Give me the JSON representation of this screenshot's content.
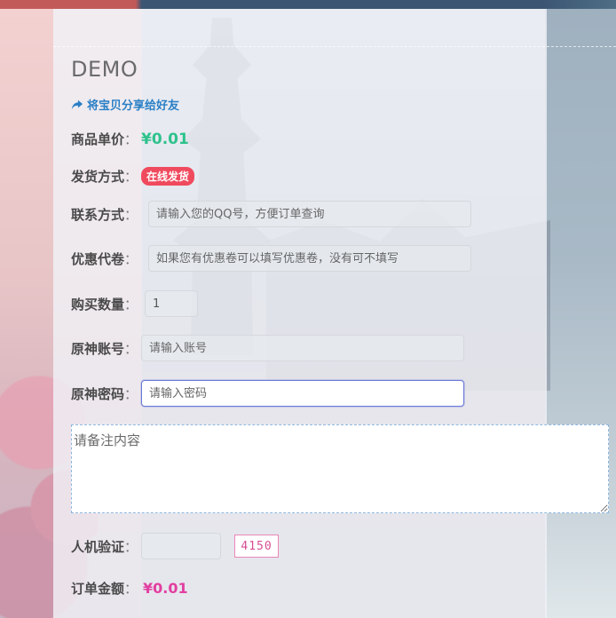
{
  "page": {
    "title": "DEMO",
    "share_label": "将宝贝分享给好友"
  },
  "fields": {
    "unit_price": {
      "label": "商品单价",
      "value": "¥0.01"
    },
    "delivery": {
      "label": "发货方式",
      "badge": "在线发货"
    },
    "contact": {
      "label": "联系方式",
      "placeholder": "请输入您的QQ号，方便订单查询"
    },
    "coupon": {
      "label": "优惠代卷",
      "placeholder": "如果您有优惠卷可以填写优惠卷，没有可不填写"
    },
    "quantity": {
      "label": "购买数量",
      "value": "1"
    },
    "account": {
      "label": "原神账号",
      "placeholder": "请输入账号"
    },
    "password": {
      "label": "原神密码",
      "placeholder": "请输入密码"
    },
    "remark": {
      "placeholder": "请备注内容"
    },
    "captcha": {
      "label": "人机验证",
      "code": "4150"
    },
    "order_total": {
      "label": "订单金额",
      "value": "¥0.01"
    }
  },
  "colors": {
    "price_green": "#2ec28c",
    "badge_red": "#f04a5e",
    "link_blue": "#2a7fc6",
    "total_pink": "#e23ea0",
    "focus_border": "#6a79d8"
  }
}
